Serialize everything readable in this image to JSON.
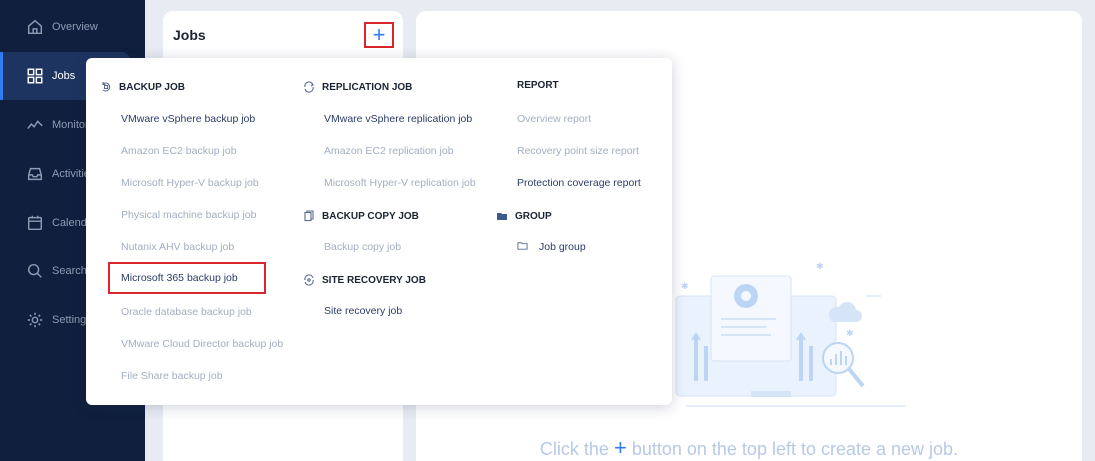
{
  "sidebar": {
    "items": [
      {
        "label": "Overview",
        "icon": "home-icon"
      },
      {
        "label": "Jobs",
        "icon": "grid-icon",
        "active": true
      },
      {
        "label": "Monitor",
        "icon": "pulse-icon"
      },
      {
        "label": "Activities",
        "icon": "inbox-icon"
      },
      {
        "label": "Calendar",
        "icon": "calendar-icon"
      },
      {
        "label": "Search",
        "icon": "search-icon"
      },
      {
        "label": "Settings",
        "icon": "gear-icon"
      }
    ]
  },
  "jobs_panel": {
    "title": "Jobs",
    "add_button": "+"
  },
  "menu": {
    "backup": {
      "header": "BACKUP JOB",
      "items": [
        "VMware vSphere backup job",
        "Amazon EC2 backup job",
        "Microsoft Hyper-V backup job",
        "Physical machine backup job",
        "Nutanix AHV backup job",
        "Microsoft 365 backup job",
        "Oracle database backup job",
        "VMware Cloud Director backup job",
        "File Share backup job"
      ]
    },
    "replication": {
      "header": "REPLICATION JOB",
      "items": [
        "VMware vSphere replication job",
        "Amazon EC2 replication job",
        "Microsoft Hyper-V replication job"
      ]
    },
    "backup_copy": {
      "header": "BACKUP COPY JOB",
      "items": [
        "Backup copy job"
      ]
    },
    "site_recovery": {
      "header": "SITE RECOVERY JOB",
      "items": [
        "Site recovery job"
      ]
    },
    "report": {
      "header": "REPORT",
      "items": [
        "Overview report",
        "Recovery point size report",
        "Protection coverage report"
      ]
    },
    "group": {
      "header": "GROUP",
      "items": [
        "Job group"
      ]
    }
  },
  "main": {
    "hint_before": "Click the",
    "hint_plus": "+",
    "hint_after": "button on the top left to create a new job."
  },
  "colors": {
    "sidebar_bg": "#0f1f3d",
    "accent": "#2f7cf6",
    "highlight_border": "#d9262c",
    "disabled_text": "#a3aec2",
    "enabled_text": "#2b3c66"
  }
}
